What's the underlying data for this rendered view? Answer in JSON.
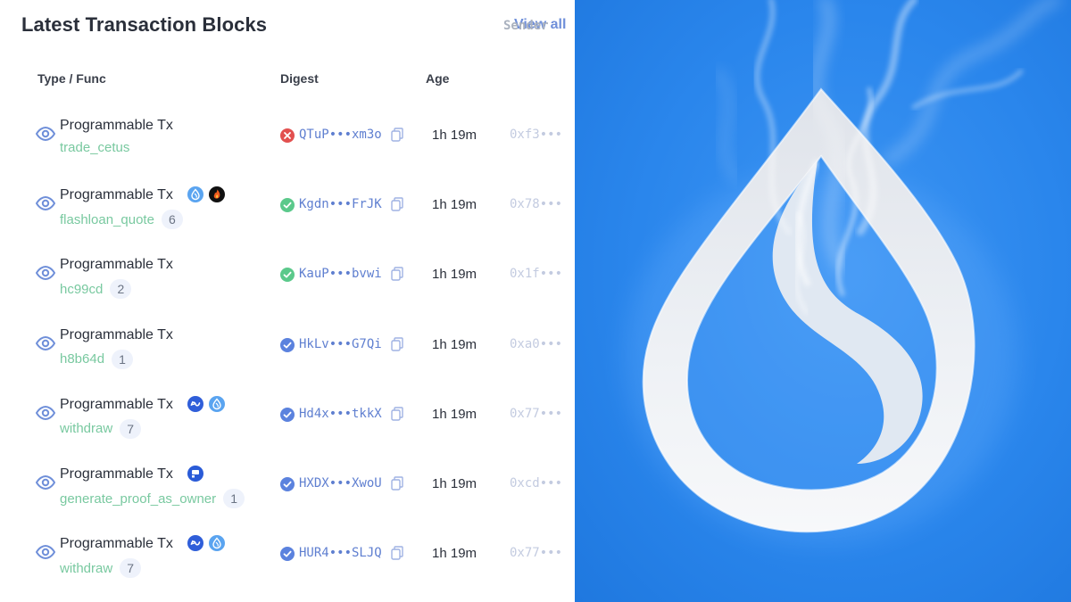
{
  "panel": {
    "title": "Latest Transaction Blocks",
    "view_all_label": "View all",
    "columns": [
      "Type / Func",
      "Digest",
      "Age",
      "Sender"
    ]
  },
  "rows": [
    {
      "type": "Programmable Tx",
      "func": "trade_cetus",
      "count": "",
      "status": "failed",
      "digest": "QTuP•••xm3o",
      "age": "1h 19m",
      "sender": "0xf3•••",
      "badges": []
    },
    {
      "type": "Programmable Tx",
      "func": "flashloan_quote",
      "count": "6",
      "status": "success",
      "digest": "Kgdn•••FrJK",
      "age": "1h 19m",
      "sender": "0x78•••",
      "badges": [
        "sui-logo-icon",
        "flame-logo-icon"
      ]
    },
    {
      "type": "Programmable Tx",
      "func": "hc99cd",
      "count": "2",
      "status": "success",
      "digest": "KauP•••bvwi",
      "age": "1h 19m",
      "sender": "0x1f•••",
      "badges": []
    },
    {
      "type": "Programmable Tx",
      "func": "h8b64d",
      "count": "1",
      "status": "verified",
      "digest": "HkLv•••G7Qi",
      "age": "1h 19m",
      "sender": "0xa0•••",
      "badges": []
    },
    {
      "type": "Programmable Tx",
      "func": "withdraw",
      "count": "7",
      "status": "verified",
      "digest": "Hd4x•••tkkX",
      "age": "1h 19m",
      "sender": "0x77•••",
      "badges": [
        "swap-logo-icon",
        "sui-logo-icon"
      ]
    },
    {
      "type": "Programmable Tx",
      "func": "generate_proof_as_owner",
      "count": "1",
      "status": "verified",
      "digest": "HXDX•••XwoU",
      "age": "1h 19m",
      "sender": "0xcd•••",
      "badges": [
        "protocol-logo-icon"
      ]
    },
    {
      "type": "Programmable Tx",
      "func": "withdraw",
      "count": "7",
      "status": "verified",
      "digest": "HUR4•••SLJQ",
      "age": "1h 19m",
      "sender": "0x77•••",
      "badges": [
        "swap-logo-icon",
        "sui-logo-icon"
      ]
    }
  ],
  "colors": {
    "accent": "#6f8fd9",
    "func_green": "#79c9a0",
    "status_failed": "#e2504f",
    "status_success": "#5bc98b",
    "status_verified": "#5b82de",
    "brand_blue": "#2a86ec"
  },
  "illustration": {
    "icon": "sui-droplet-logo-with-smoke"
  }
}
